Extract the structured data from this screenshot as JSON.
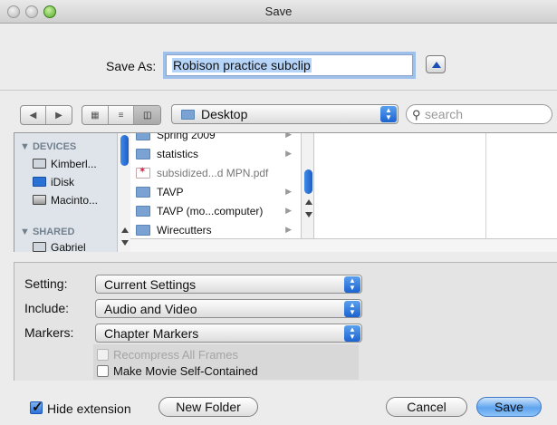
{
  "window": {
    "title": "Save"
  },
  "save_as": {
    "label": "Save As:",
    "value": "Robison practice subclip"
  },
  "toolbar": {
    "location": "Desktop",
    "search_placeholder": "search",
    "view_modes": [
      "icon-view",
      "list-view",
      "column-view"
    ],
    "active_view": "column-view"
  },
  "sidebar": {
    "sections": [
      {
        "header": "DEVICES",
        "items": [
          "Kimberl...",
          "iDisk",
          "Macinto..."
        ]
      },
      {
        "header": "SHARED",
        "items": [
          "Gabriel"
        ]
      }
    ]
  },
  "files": [
    {
      "name": "Spring 2009",
      "kind": "folder",
      "dim": false
    },
    {
      "name": "statistics",
      "kind": "folder",
      "dim": false
    },
    {
      "name": "subsidized...d MPN.pdf",
      "kind": "pdf",
      "dim": true
    },
    {
      "name": "TAVP",
      "kind": "folder",
      "dim": false
    },
    {
      "name": "TAVP (mo...computer)",
      "kind": "folder",
      "dim": false
    },
    {
      "name": "Wirecutters",
      "kind": "folder",
      "dim": false
    }
  ],
  "options": {
    "setting": {
      "label": "Setting:",
      "value": "Current Settings"
    },
    "include": {
      "label": "Include:",
      "value": "Audio and Video"
    },
    "markers": {
      "label": "Markers:",
      "value": "Chapter Markers"
    },
    "recompress": {
      "label": "Recompress All Frames",
      "checked": false,
      "enabled": false
    },
    "self_contained": {
      "label": "Make Movie Self-Contained",
      "checked": false,
      "enabled": true
    }
  },
  "bottom": {
    "hide_extension": {
      "label": "Hide extension",
      "checked": true
    },
    "new_folder": "New Folder",
    "cancel": "Cancel",
    "save": "Save"
  },
  "colors": {
    "accent": "#5ea4ef",
    "selection": "#b5d4f7",
    "sidebar": "#dee4ea"
  },
  "icons": [
    "close-light",
    "minimize-light",
    "zoom-light",
    "back-icon",
    "forward-icon",
    "folder-icon",
    "search-icon",
    "pdf-icon",
    "checkmark-icon"
  ]
}
